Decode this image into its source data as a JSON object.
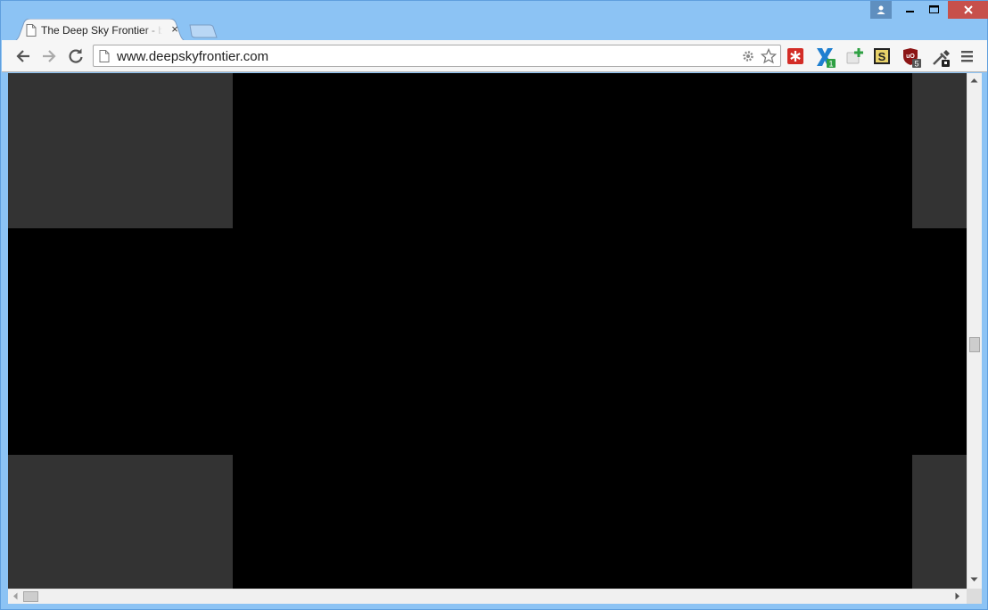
{
  "tab": {
    "title": "The Deep Sky Frontier - br",
    "close_symbol": "×"
  },
  "toolbar": {
    "url": "www.deepskyfrontier.com"
  },
  "extensions": {
    "lastpass_badge": "",
    "blue_ext_badge": "1",
    "ublock_badge": "5",
    "ublock_label": "uO",
    "s_label": "S"
  },
  "colors": {
    "frame": "#8cc3f4",
    "close_button": "#c7504b",
    "page_background": "#000000",
    "panel": "#333333"
  },
  "icons": [
    "page-icon",
    "back-arrow-icon",
    "forward-arrow-icon",
    "reload-icon",
    "gear-icon",
    "star-icon",
    "lastpass-icon",
    "blue-ext-icon",
    "green-plus-icon",
    "s-ext-icon",
    "ublock-icon",
    "dropper-icon",
    "hamburger-menu-icon",
    "user-profile-icon",
    "minimize-icon",
    "maximize-icon",
    "close-icon"
  ]
}
